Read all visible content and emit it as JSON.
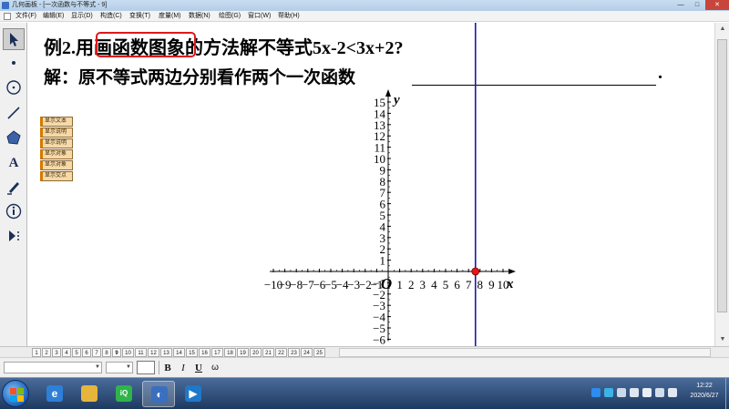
{
  "window": {
    "title": "几何画板 - [一次函数与不等式 - 9]",
    "minimize": "—",
    "maximize": "□",
    "close": "✕"
  },
  "menu": [
    "文件(F)",
    "编辑(E)",
    "显示(D)",
    "构造(C)",
    "变换(T)",
    "度量(M)",
    "数据(N)",
    "绘图(G)",
    "窗口(W)",
    "帮助(H)"
  ],
  "toolbox": [
    "arrow-select-icon",
    "point-icon",
    "compass-circle-icon",
    "line-segment-icon",
    "polygon-icon",
    "text-icon",
    "marker-pen-icon",
    "info-icon",
    "custom-tool-icon"
  ],
  "question": {
    "prefix": "例2.用",
    "highlight": "画函数图象",
    "suffix": "的方法解不等式5x-2<3x+2?",
    "answer": "解：原不等式两边分别看作两个一次函数",
    "blank_end": "."
  },
  "action_buttons": [
    "显示文本",
    "显示说明",
    "显示说明",
    "显示对象",
    "显示对象",
    "显示交点"
  ],
  "chart_data": {
    "type": "scatter",
    "title": "",
    "xlabel": "x",
    "ylabel": "y",
    "origin_label": "O",
    "xlim": [
      -10,
      10
    ],
    "ylim": [
      -6,
      15
    ],
    "xticks": [
      "−10",
      "−9",
      "−8",
      "−7",
      "−6",
      "−5",
      "−4",
      "−3",
      "−2",
      "−1",
      "1",
      "2",
      "3",
      "4",
      "5",
      "6",
      "7",
      "8",
      "9",
      "10"
    ],
    "yticks": [
      "15",
      "14",
      "13",
      "12",
      "11",
      "10",
      "9",
      "8",
      "7",
      "6",
      "5",
      "4",
      "3",
      "2",
      "1",
      "−1",
      "−2",
      "−3",
      "−4",
      "−5",
      "−6"
    ],
    "vertical_line_x": 7.6,
    "points": [
      {
        "x": 7.6,
        "y": 0
      }
    ],
    "grid": false,
    "colors": {
      "axes": "#000000",
      "line": "#1a1aa0",
      "point": "#e01818"
    }
  },
  "page_tabs": [
    "1",
    "2",
    "3",
    "4",
    "5",
    "6",
    "7",
    "8",
    "9",
    "10",
    "11",
    "12",
    "13",
    "14",
    "15",
    "16",
    "17",
    "18",
    "19",
    "20",
    "21",
    "22",
    "23",
    "24",
    "25"
  ],
  "active_page": "9",
  "format_bar": {
    "bold": "B",
    "italic": "I",
    "underline": "U",
    "symbol": "ω"
  },
  "taskbar": {
    "clock_time": "12:22",
    "clock_date": "2020/6/27",
    "apps": [
      "internet-explorer-icon",
      "file-explorer-icon",
      "iqiyi-icon",
      "geometer-sketchpad-icon",
      "media-player-icon"
    ]
  }
}
